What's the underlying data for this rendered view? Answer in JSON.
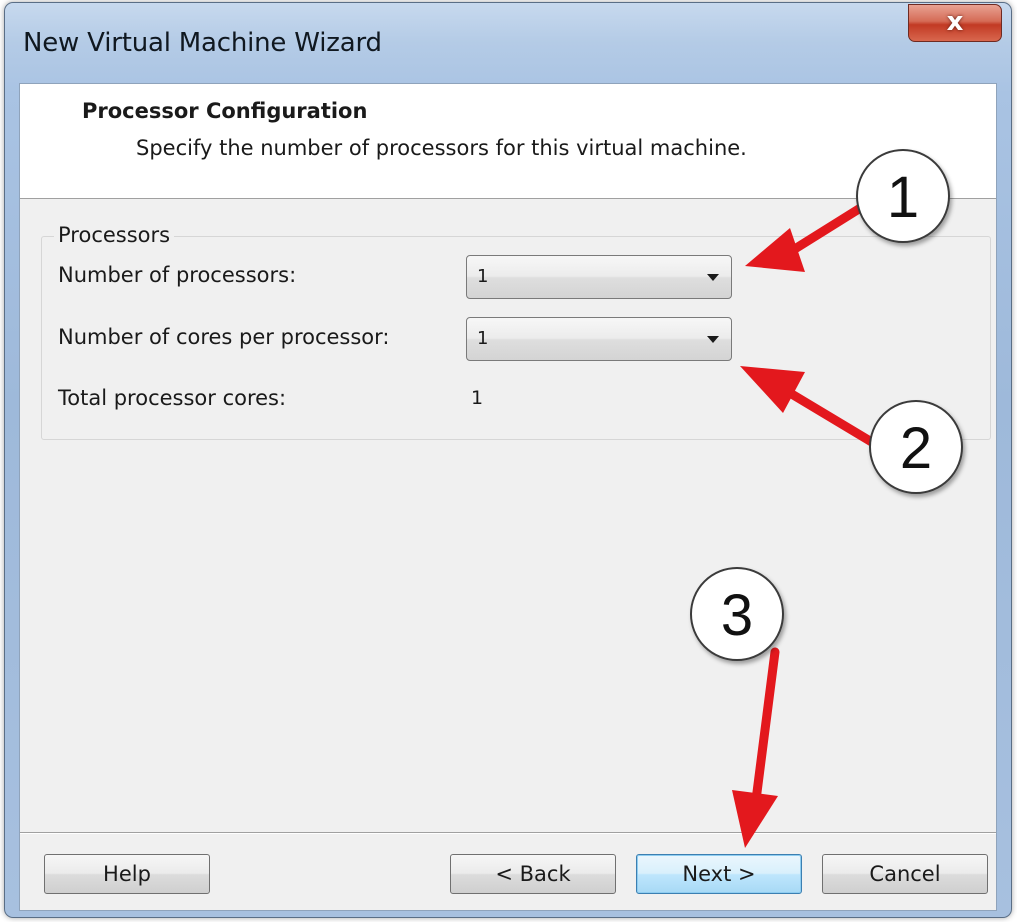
{
  "window": {
    "title": "New Virtual Machine Wizard",
    "close_glyph": "x"
  },
  "header": {
    "title": "Processor Configuration",
    "subtitle": "Specify the number of processors for this virtual machine."
  },
  "processors": {
    "group_label": "Processors",
    "num_processors_label": "Number of processors:",
    "num_processors_value": "1",
    "cores_per_processor_label": "Number of cores per processor:",
    "cores_per_processor_value": "1",
    "total_cores_label": "Total processor cores:",
    "total_cores_value": "1"
  },
  "buttons": {
    "help": "Help",
    "back": "< Back",
    "next": "Next >",
    "cancel": "Cancel"
  },
  "annotations": {
    "callout_1": "1",
    "callout_2": "2",
    "callout_3": "3",
    "arrow_color": "#e3181d"
  }
}
